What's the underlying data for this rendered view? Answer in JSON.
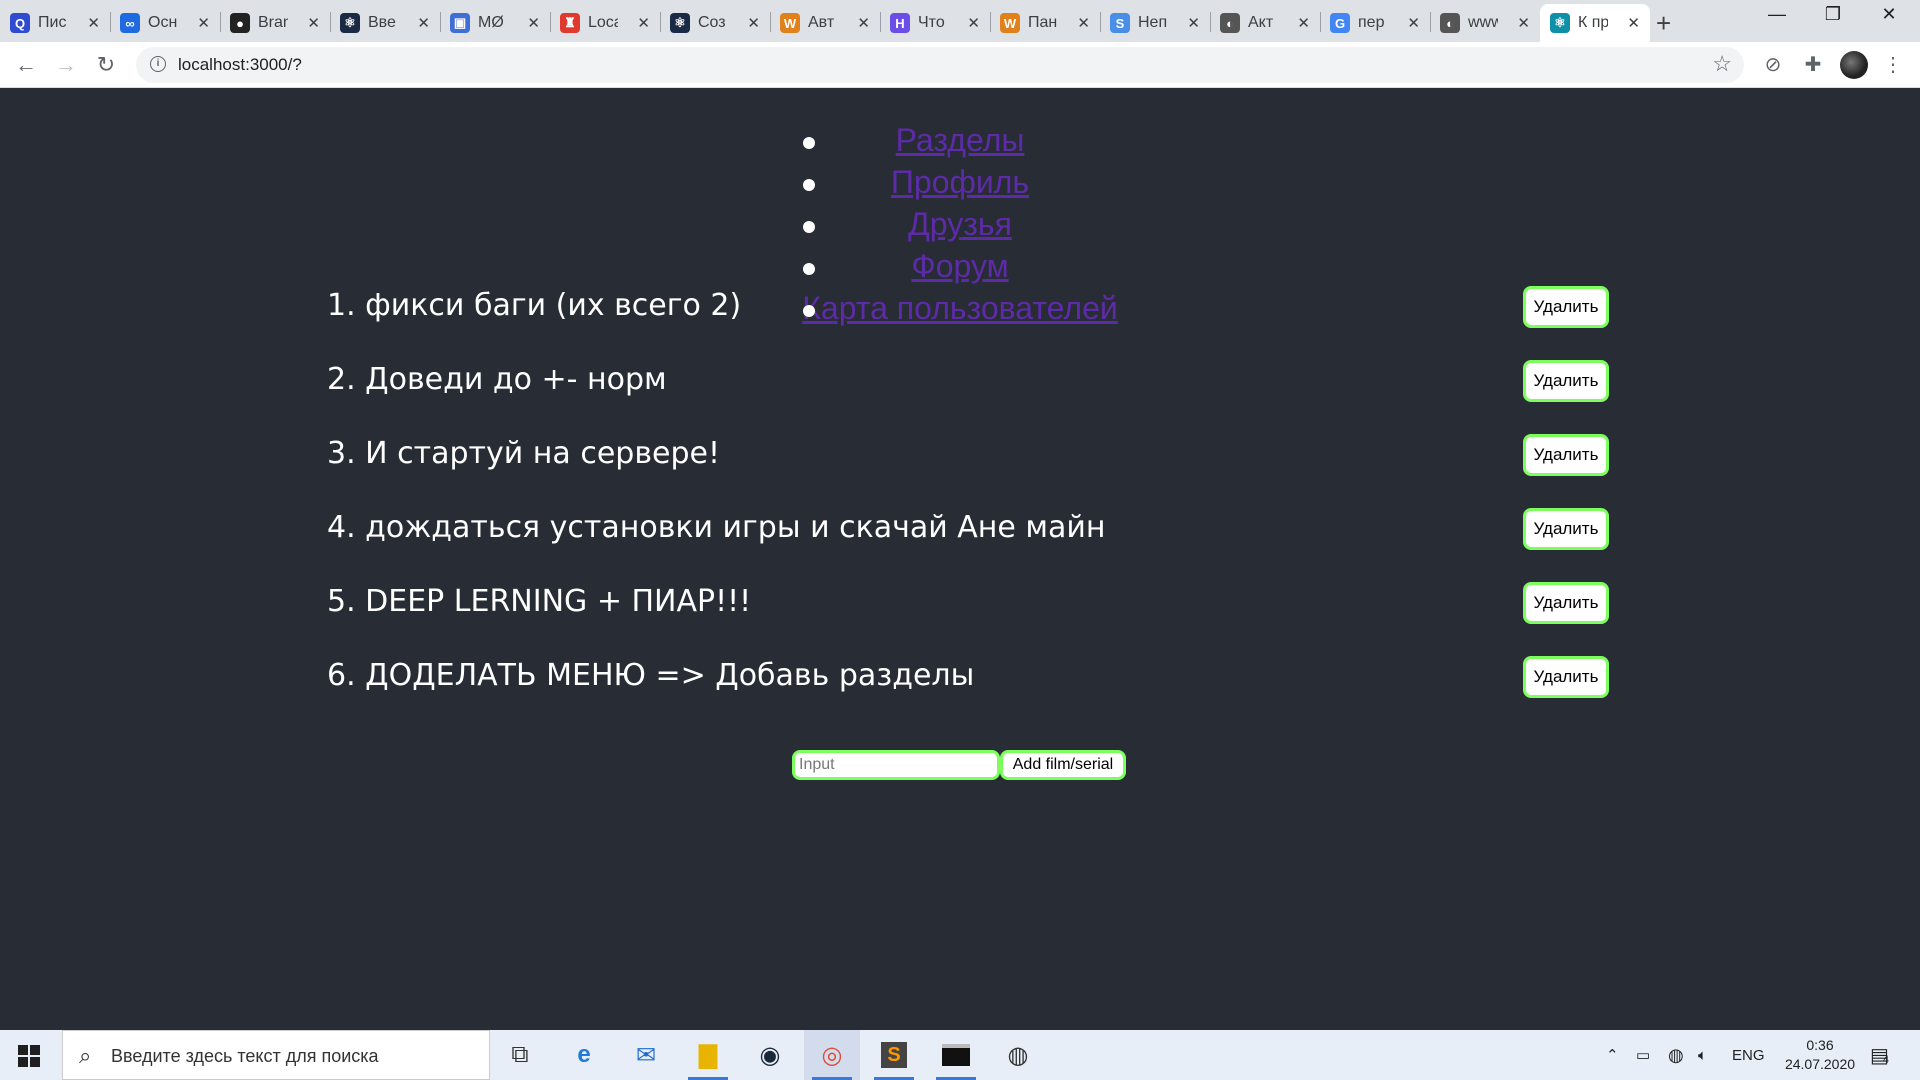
{
  "browser": {
    "tabs": [
      {
        "icon": "q-icon",
        "glyph": "Q",
        "color": "#2f4bd0",
        "label": "Пис"
      },
      {
        "icon": "infinity-icon",
        "glyph": "∞",
        "color": "#1e6ae1",
        "label": "Осн"
      },
      {
        "icon": "github-icon",
        "glyph": "●",
        "color": "#222222",
        "label": "Bran"
      },
      {
        "icon": "react-icon",
        "glyph": "⚛",
        "color": "#1b2a44",
        "label": "Вве"
      },
      {
        "icon": "chat-icon",
        "glyph": "▣",
        "color": "#3f6fd6",
        "label": "MØ"
      },
      {
        "icon": "tower-icon",
        "glyph": "♜",
        "color": "#e03a2f",
        "label": "Loca"
      },
      {
        "icon": "react-icon",
        "glyph": "⚛",
        "color": "#1b2a44",
        "label": "Соз"
      },
      {
        "icon": "w-icon",
        "glyph": "W",
        "color": "#e0811c",
        "label": "Авт"
      },
      {
        "icon": "h-icon",
        "glyph": "H",
        "color": "#6b4ee6",
        "label": "Что"
      },
      {
        "icon": "w-icon",
        "glyph": "W",
        "color": "#e0811c",
        "label": "Пан"
      },
      {
        "icon": "s-icon",
        "glyph": "S",
        "color": "#4a8fe7",
        "label": "Неп"
      },
      {
        "icon": "globe-icon",
        "glyph": "◐",
        "color": "#555555",
        "label": "Акт"
      },
      {
        "icon": "google-icon",
        "glyph": "G",
        "color": "#4285f4",
        "label": "пер"
      },
      {
        "icon": "globe-icon",
        "glyph": "◐",
        "color": "#555555",
        "label": "www"
      },
      {
        "icon": "react-icon",
        "glyph": "⚛",
        "color": "#0f8fa8",
        "label": "К пр"
      }
    ],
    "active_tab_index": 14,
    "url": "localhost:3000/?"
  },
  "menu": {
    "items": [
      "Разделы",
      "Профиль",
      "Друзья",
      "Форум",
      "Карта пользователей"
    ]
  },
  "todos": [
    {
      "text": "1. фикси баги (их всего 2)",
      "button": "Удалить"
    },
    {
      "text": "2. Доведи до +- норм",
      "button": "Удалить"
    },
    {
      "text": "3. И стартуй на сервере!",
      "button": "Удалить"
    },
    {
      "text": "4. дождаться установки игры и скачай Ане майн",
      "button": "Удалить"
    },
    {
      "text": "5. DEEP LERNING + ПИАР!!!",
      "button": "Удалить"
    },
    {
      "text": "6. ДОДЕЛАТЬ МЕНЮ => Добавь разделы",
      "button": "Удалить"
    }
  ],
  "add_form": {
    "placeholder": "Input",
    "button": "Add film/serial"
  },
  "taskbar": {
    "search_placeholder": "Введите здесь текст для поиска",
    "language": "ENG",
    "time": "0:36",
    "date": "24.07.2020",
    "notification_count": "4"
  },
  "colors": {
    "page_background": "#282c34",
    "link": "#5d2ba8",
    "button_border": "#7cff5c"
  }
}
